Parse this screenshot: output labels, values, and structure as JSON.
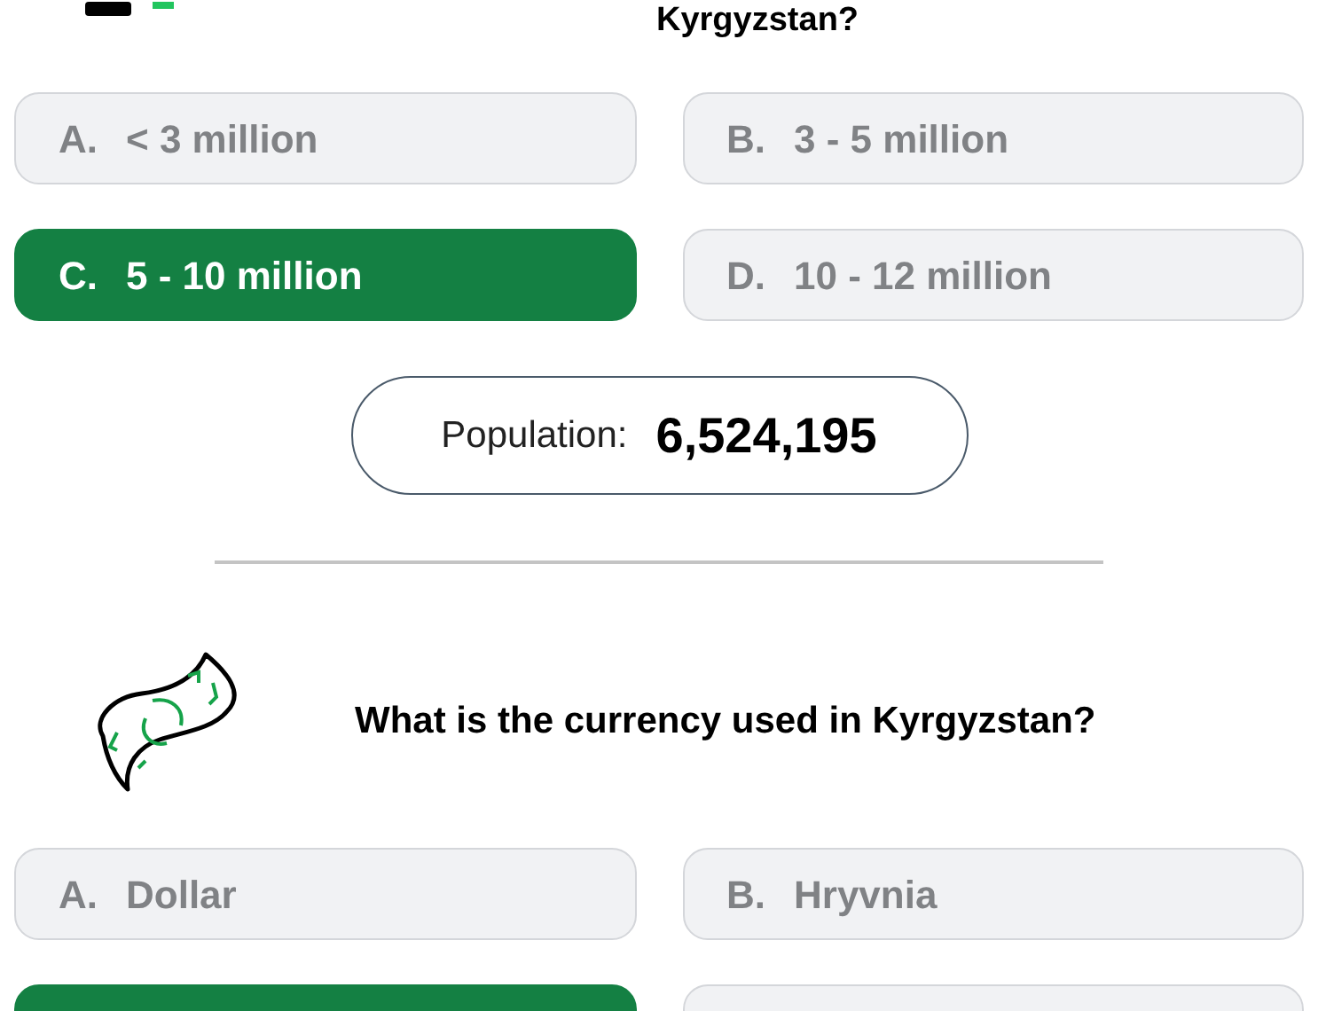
{
  "questions": [
    {
      "kind": "population",
      "question": "Kyrgyzstan?",
      "options": [
        {
          "letter": "A.",
          "text": "< 3 million",
          "selected": false
        },
        {
          "letter": "B.",
          "text": "3 - 5 million",
          "selected": false
        },
        {
          "letter": "C.",
          "text": "5 - 10 million",
          "selected": true
        },
        {
          "letter": "D.",
          "text": "10 - 12 million",
          "selected": false
        }
      ],
      "answer": {
        "label": "Population:",
        "value": "6,524,195"
      }
    },
    {
      "kind": "currency",
      "question": "What is the currency used in Kyrgyzstan?",
      "options": [
        {
          "letter": "A.",
          "text": "Dollar",
          "selected": false
        },
        {
          "letter": "B.",
          "text": "Hryvnia",
          "selected": false
        },
        {
          "selected": true
        },
        {
          "selected": false
        }
      ]
    }
  ]
}
